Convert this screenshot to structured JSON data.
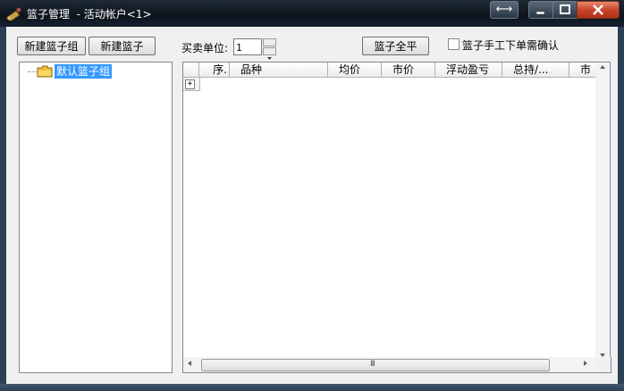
{
  "window": {
    "title": "篮子管理  - 活动帐户<1>",
    "extra_button_symbol": "⟷",
    "colors": {
      "selection": "#3399ff",
      "titlebar": "#0d141c",
      "close": "#c8442a"
    }
  },
  "toolbar": {
    "new_group_label": "新建篮子组",
    "new_basket_label": "新建篮子",
    "unit_label": "买卖单位:",
    "unit_value": "1",
    "close_all_label": "篮子全平",
    "manual_confirm_label": "篮子手工下单需确认",
    "manual_confirm_checked": false
  },
  "tree": {
    "items": [
      {
        "label": "默认篮子组",
        "selected": true,
        "icon": "folder-icon"
      }
    ]
  },
  "grid": {
    "columns": [
      "序.",
      "品种",
      "均价",
      "市价",
      "浮动盈亏",
      "总持/...",
      "市"
    ],
    "row_expander": "+"
  },
  "scrollbars": {
    "grip": "III"
  }
}
